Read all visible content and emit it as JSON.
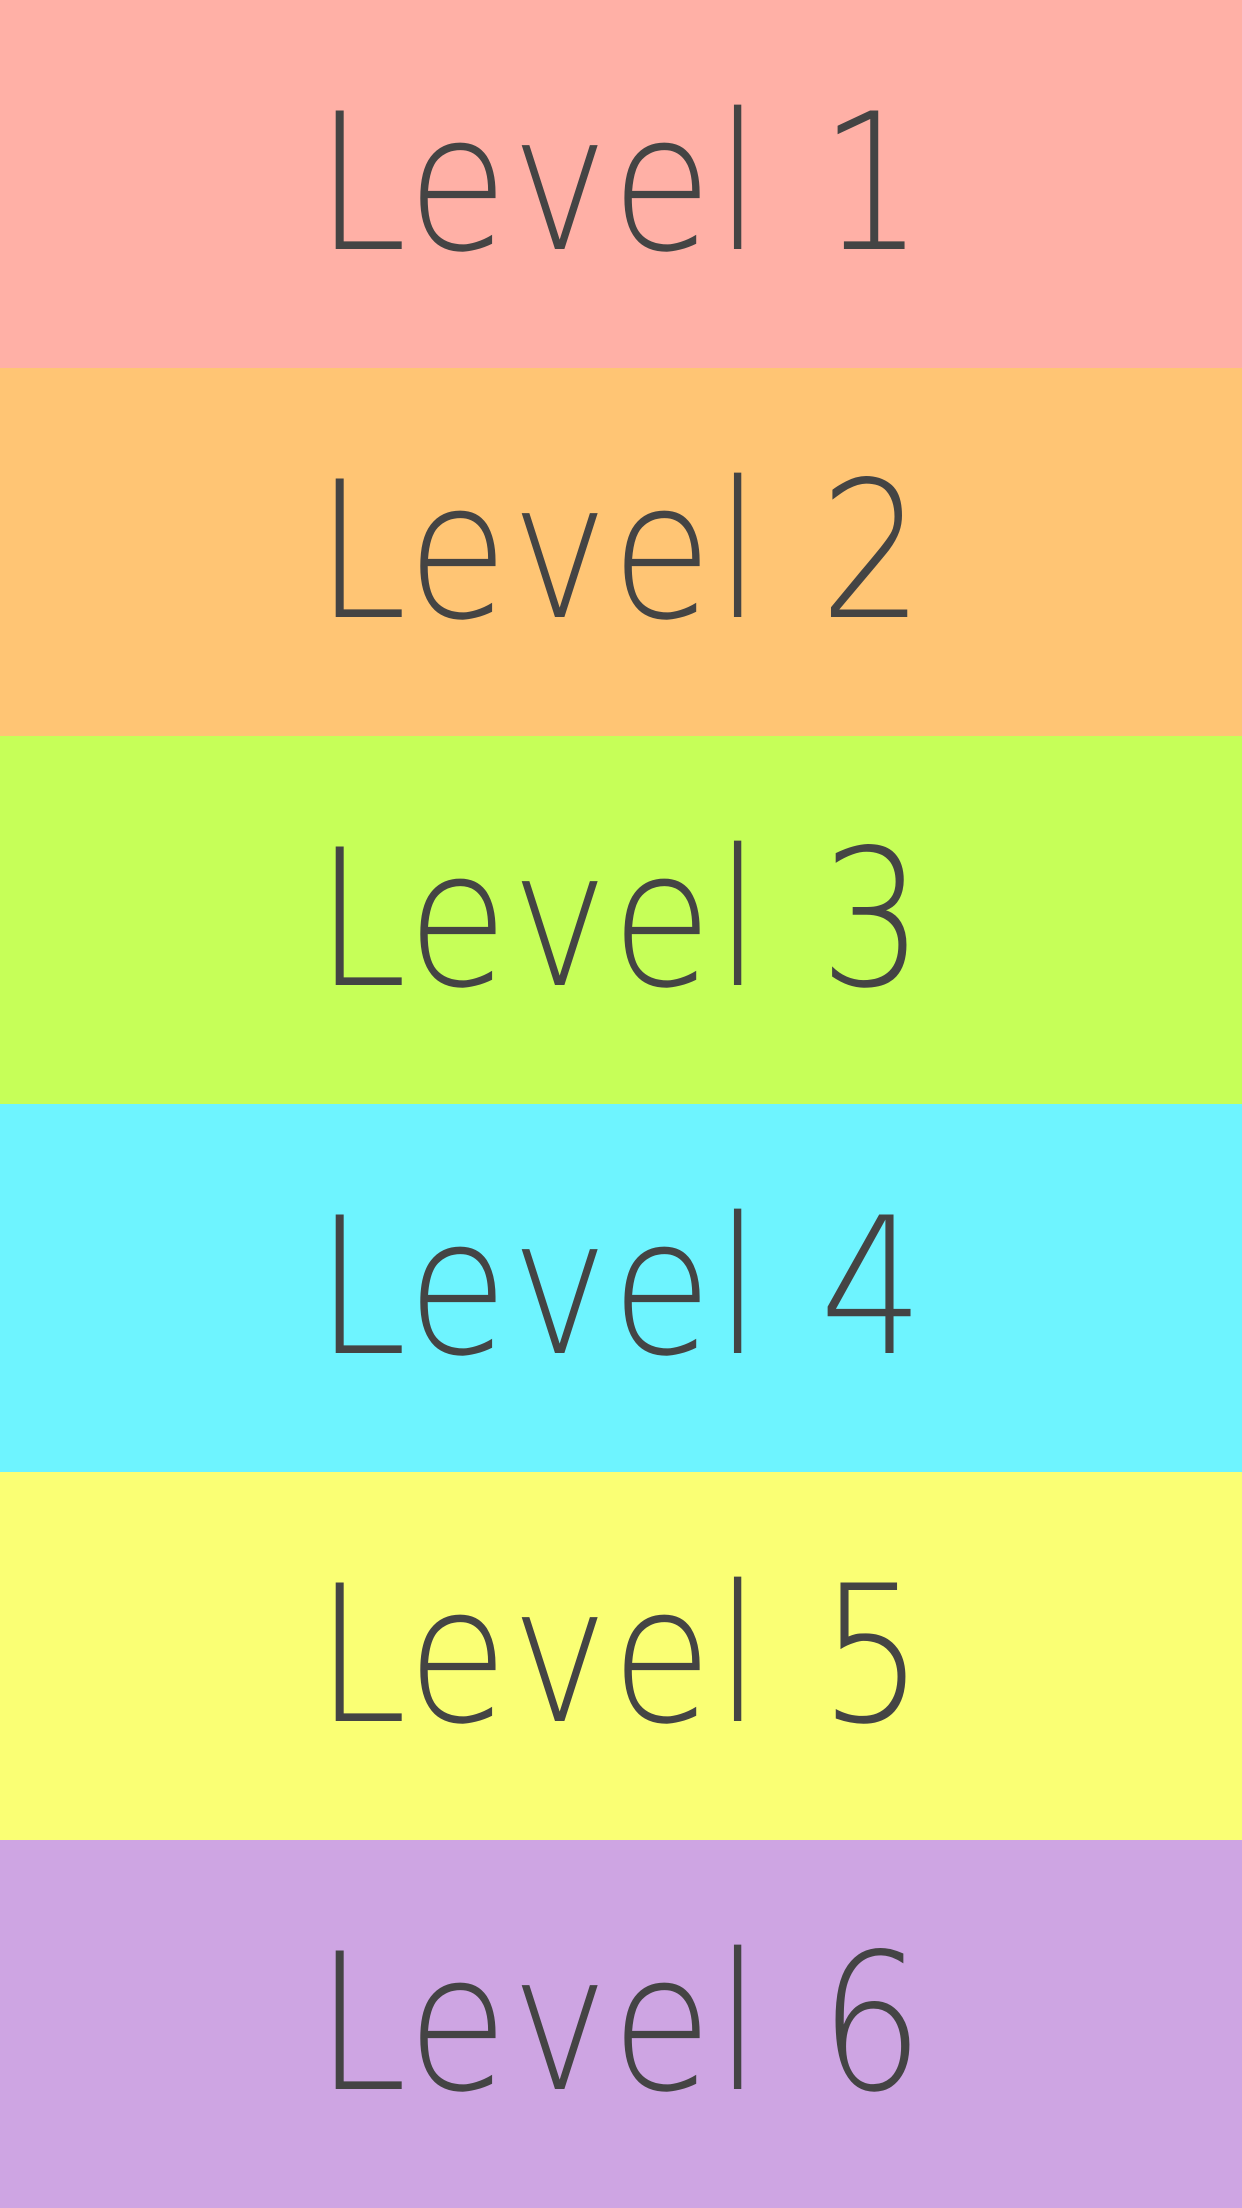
{
  "levels": [
    {
      "label": "Level 1",
      "color": "#FFB0A6"
    },
    {
      "label": "Level 2",
      "color": "#FFC574"
    },
    {
      "label": "Level 3",
      "color": "#C6FF58"
    },
    {
      "label": "Level 4",
      "color": "#6EF4FF"
    },
    {
      "label": "Level 5",
      "color": "#FAFF74"
    },
    {
      "label": "Level 6",
      "color": "#CEA5E3"
    }
  ],
  "text_color": "#444444"
}
